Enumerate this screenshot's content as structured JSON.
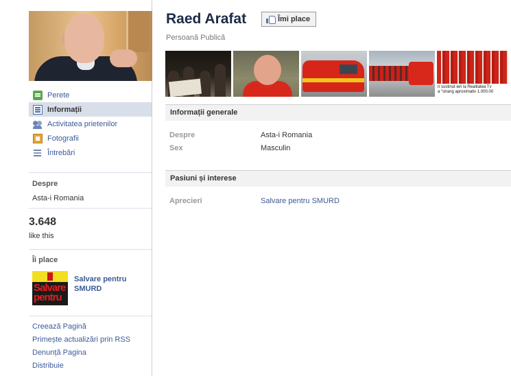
{
  "profile": {
    "name": "Raed Arafat",
    "category": "Persoană Publică",
    "like_button": "Îmi place"
  },
  "nav": {
    "items": [
      {
        "label": "Perete",
        "icon": "wall-icon",
        "active": false
      },
      {
        "label": "Informații",
        "icon": "info-icon",
        "active": true
      },
      {
        "label": "Activitatea prietenilor",
        "icon": "friends-icon",
        "active": false
      },
      {
        "label": "Fotografii",
        "icon": "photos-icon",
        "active": false
      },
      {
        "label": "Întrebări",
        "icon": "questions-icon",
        "active": false
      }
    ]
  },
  "sidebar": {
    "about_label": "Despre",
    "about_text": "Asta-i Romania",
    "likes_count": "3.648",
    "likes_label": "like this",
    "likes_section_label": "Îi place",
    "liked_page_name": "Salvare pentru SMURD",
    "liked_thumb_text": "Salvare pentru",
    "footer_links": [
      "Creează Pagină",
      "Primește actualizări prin RSS",
      "Denunță Pagina",
      "Distribuie"
    ]
  },
  "photo_strip": {
    "caption_line1": "n sustinut ieri la Realitatea Tv",
    "caption_line2": "a \"strang aproximativ 1.000.00"
  },
  "general_info": {
    "title": "Informații generale",
    "rows": [
      {
        "label": "Despre",
        "value": "Asta-i Romania"
      },
      {
        "label": "Sex",
        "value": "Masculin"
      }
    ]
  },
  "interests": {
    "title": "Pasiuni și interese",
    "rows": [
      {
        "label": "Aprecieri",
        "value": "Salvare pentru SMURD"
      }
    ]
  },
  "colors": {
    "link": "#3b5998",
    "active_nav_bg": "#d8dfea",
    "section_bg": "#f2f2f2"
  }
}
